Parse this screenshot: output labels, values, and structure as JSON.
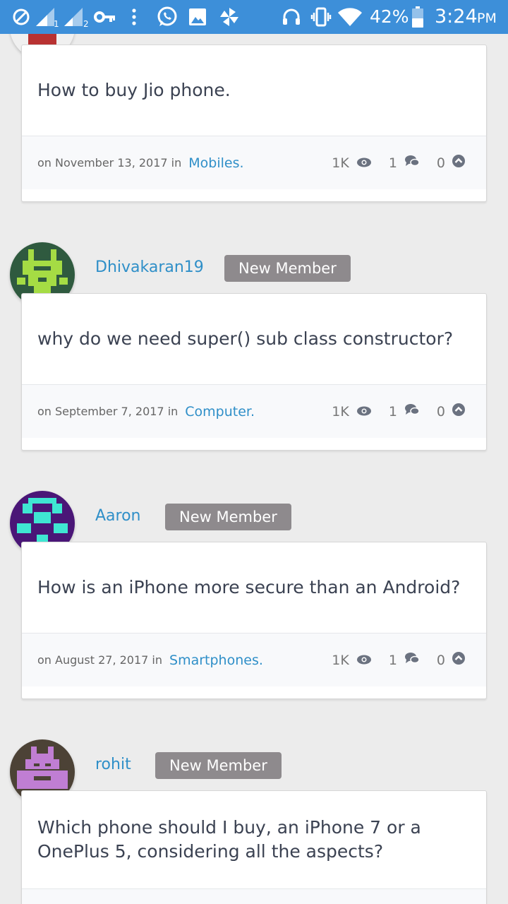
{
  "status_bar": {
    "battery": "42%",
    "time": "3:24",
    "ampm": "PM",
    "sim1": "1",
    "sim2": "2"
  },
  "questions": [
    {
      "title": "How to buy Jio phone.",
      "on": "on November 13, 2017 in",
      "category": "Mobiles.",
      "views": "1K",
      "answers": "1",
      "votes": "0"
    },
    {
      "user": "Dhivakaran19",
      "badge": "New Member",
      "title": "why do we need super() sub class constructor?",
      "on": "on September 7, 2017 in",
      "category": "Computer.",
      "views": "1K",
      "answers": "1",
      "votes": "0"
    },
    {
      "user": "Aaron",
      "badge": "New Member",
      "title": "How is an iPhone more secure than an Android?",
      "on": "on August 27, 2017 in",
      "category": "Smartphones.",
      "views": "1K",
      "answers": "1",
      "votes": "0"
    },
    {
      "user": "rohit",
      "badge": "New Member",
      "title": "Which phone should I buy, an iPhone 7 or a OnePlus 5, considering all the aspects?"
    }
  ],
  "colors": {
    "status_bar": "#3d8fd9",
    "link": "#2f8fc8",
    "badge": "#8e8a8d",
    "title_text": "#3b4252"
  }
}
